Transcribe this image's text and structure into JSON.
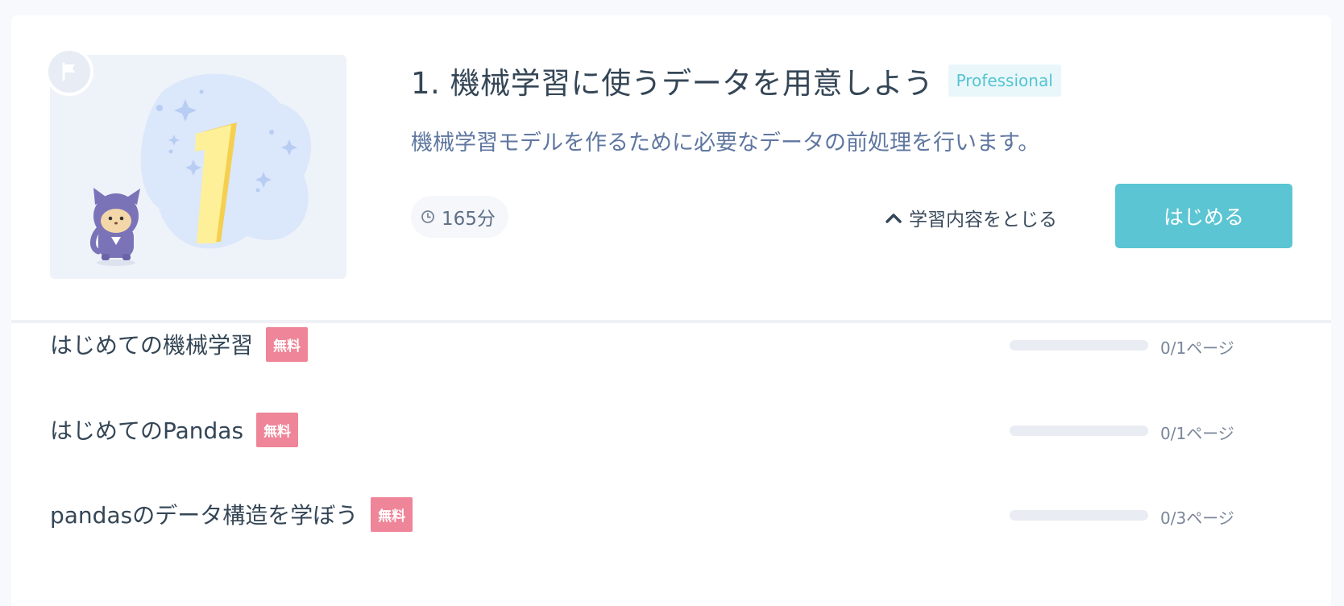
{
  "course": {
    "title": "1. 機械学習に使うデータを用意しよう",
    "level_badge": "Professional",
    "description": "機械学習モデルを作るために必要なデータの前処理を行います。",
    "duration": "165分",
    "toggle_label": "学習内容をとじる",
    "start_label": "はじめる"
  },
  "lessons": [
    {
      "name": "はじめての機械学習",
      "badge": "無料",
      "progress_text": "0/1ページ",
      "progress": 0
    },
    {
      "name": "はじめてのPandas",
      "badge": "無料",
      "progress_text": "0/1ページ",
      "progress": 0
    },
    {
      "name": "pandasのデータ構造を学ぼう",
      "badge": "無料",
      "progress_text": "0/3ページ",
      "progress": 0
    }
  ],
  "colors": {
    "accent": "#5bc5d3",
    "free_badge": "#ef8598",
    "title_text": "#344656",
    "description_text": "#5f77a0"
  },
  "icons": {
    "flag": "flag-icon",
    "clock": "clock-icon",
    "chevron": "chevron-up-icon"
  }
}
